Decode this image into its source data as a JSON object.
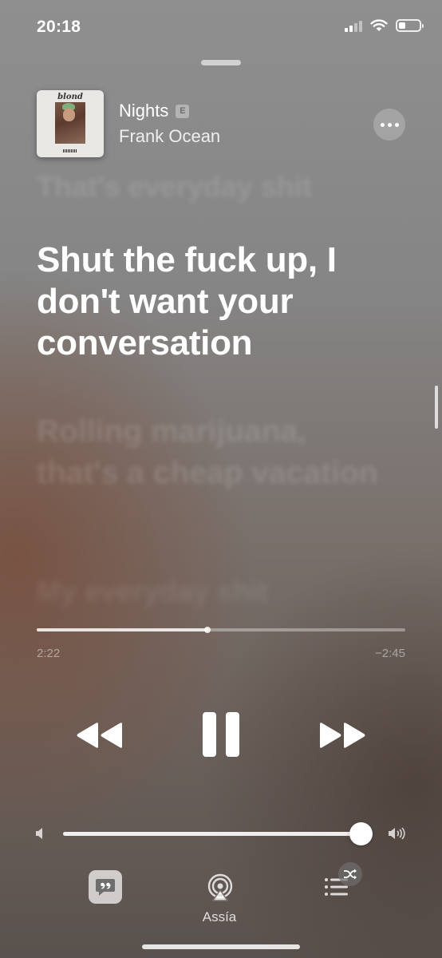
{
  "status_bar": {
    "time": "20:18"
  },
  "now_playing": {
    "album_art_logo": "blond",
    "title": "Nights",
    "explicit_badge": "E",
    "artist": "Frank Ocean"
  },
  "lyrics": {
    "previous": "That's everyday shit",
    "current": "Shut the fuck up, I don't want your conversation",
    "next": "Rolling marijuana, that's a cheap vacation",
    "next2": "My everyday shit"
  },
  "playback": {
    "elapsed": "2:22",
    "remaining": "−2:45",
    "progress_fraction": 0.464,
    "volume_fraction": 1.0
  },
  "bottom_bar": {
    "device_label": "Assía"
  },
  "icons": {
    "more": "ellipsis-icon",
    "rewind": "rewind-icon",
    "pause": "pause-icon",
    "forward": "fast-forward-icon",
    "volume_low": "speaker-low-icon",
    "volume_high": "speaker-high-icon",
    "lyrics": "lyrics-quote-icon",
    "airplay": "airplay-icon",
    "queue": "queue-list-icon",
    "shuffle": "shuffle-icon"
  }
}
